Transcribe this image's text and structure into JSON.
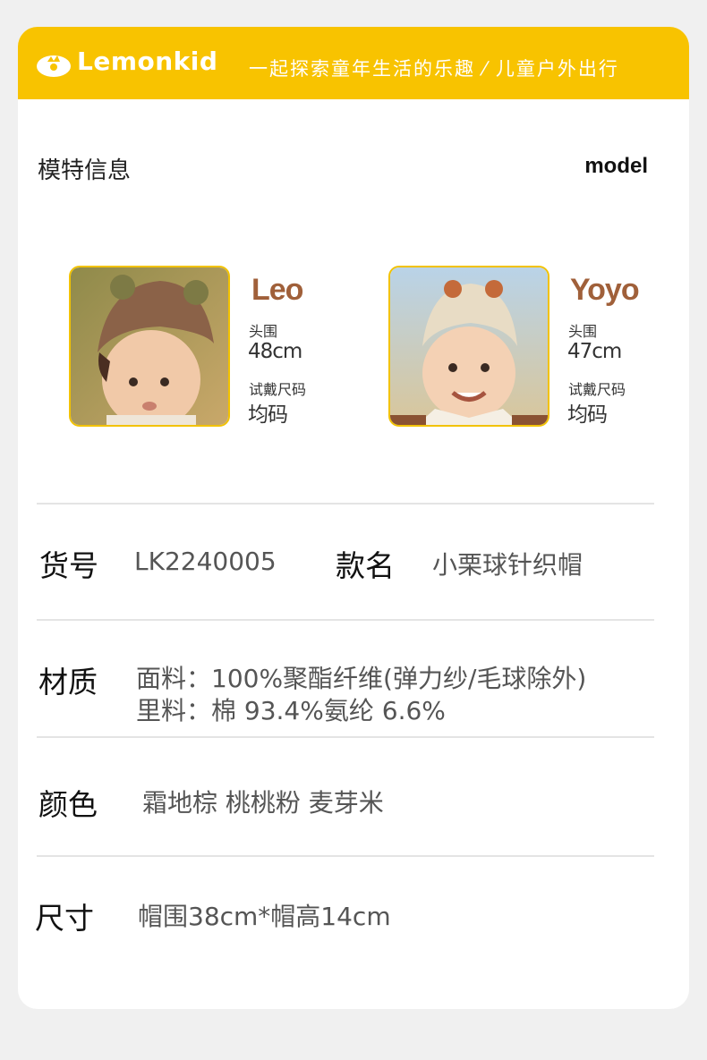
{
  "header": {
    "brand": "Lemonkid",
    "slogan": "一起探索童年生活的乐趣 ⁄ 儿童户外出行",
    "colors": {
      "banner": "#f8c300",
      "accent": "#a0603a"
    }
  },
  "section": {
    "title": "模特信息",
    "title_en": "model"
  },
  "models": [
    {
      "name": "Leo",
      "head_label": "头围",
      "head_value": "48cm",
      "size_label": "试戴尺码",
      "size_value": "均码",
      "photo": "baby-in-brown-knit-hat"
    },
    {
      "name": "Yoyo",
      "head_label": "头围",
      "head_value": "47cm",
      "size_label": "试戴尺码",
      "size_value": "均码",
      "photo": "baby-in-beige-knit-hat"
    }
  ],
  "specs": {
    "item_no_label": "货号",
    "item_no": "LK2240005",
    "name_label": "款名",
    "name": "小栗球针织帽",
    "material_label": "材质",
    "material_line1": "面料：100%聚酯纤维(弹力纱/毛球除外)",
    "material_line2": "里料：棉 93.4%氨纶 6.6%",
    "color_label": "颜色",
    "colors": "霜地棕  桃桃粉  麦芽米",
    "size_label": "尺寸",
    "size": "帽围38cm*帽高14cm"
  }
}
